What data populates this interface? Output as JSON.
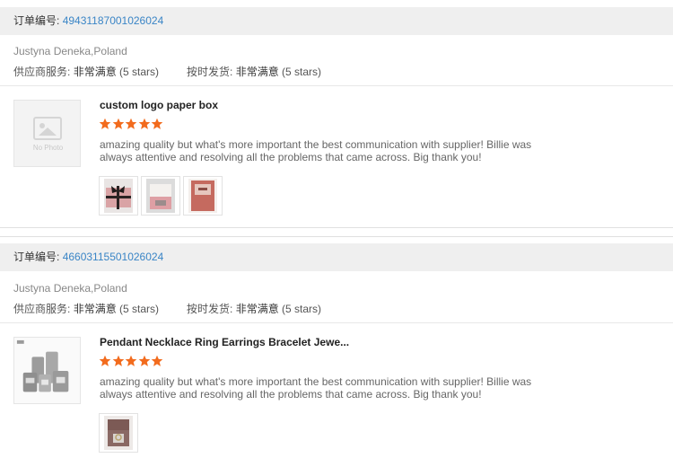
{
  "reviews": [
    {
      "order_label": "订单编号:",
      "order_number": "49431187001026024",
      "buyer": "Justyna Deneka,Poland",
      "supplier_label": "供应商服务:",
      "supplier_value": "非常满意",
      "supplier_stars": "(5 stars)",
      "delivery_label": "按时发货:",
      "delivery_value": "非常满意",
      "delivery_stars": "(5 stars)",
      "no_photo_text": "No Photo",
      "product_title": "custom logo paper box",
      "rating": 5,
      "comment": "amazing quality but what's more important the best communication with supplier! Billie was always attentive and resolving all the problems that came across. Big thank you!",
      "photos": [
        "pink box with black bow",
        "pink box with card",
        "red box with lid"
      ]
    },
    {
      "order_label": "订单编号:",
      "order_number": "46603115501026024",
      "buyer": "Justyna Deneka,Poland",
      "supplier_label": "供应商服务:",
      "supplier_value": "非常满意",
      "supplier_stars": "(5 stars)",
      "delivery_label": "按时发货:",
      "delivery_value": "非常满意",
      "delivery_stars": "(5 stars)",
      "product_title": "Pendant Necklace Ring Earrings Bracelet Jewe...",
      "rating": 5,
      "comment": "amazing quality but what's more important the best communication with supplier! Billie was always attentive and resolving all the problems that came across. Big thank you!",
      "photos": [
        "jewelry box with ring"
      ]
    }
  ],
  "colors": {
    "link": "#3a85c6",
    "star": "#f26b1d",
    "bar": "#efefef"
  },
  "icons": {
    "star": "star-icon",
    "no_photo": "no-photo-icon"
  }
}
